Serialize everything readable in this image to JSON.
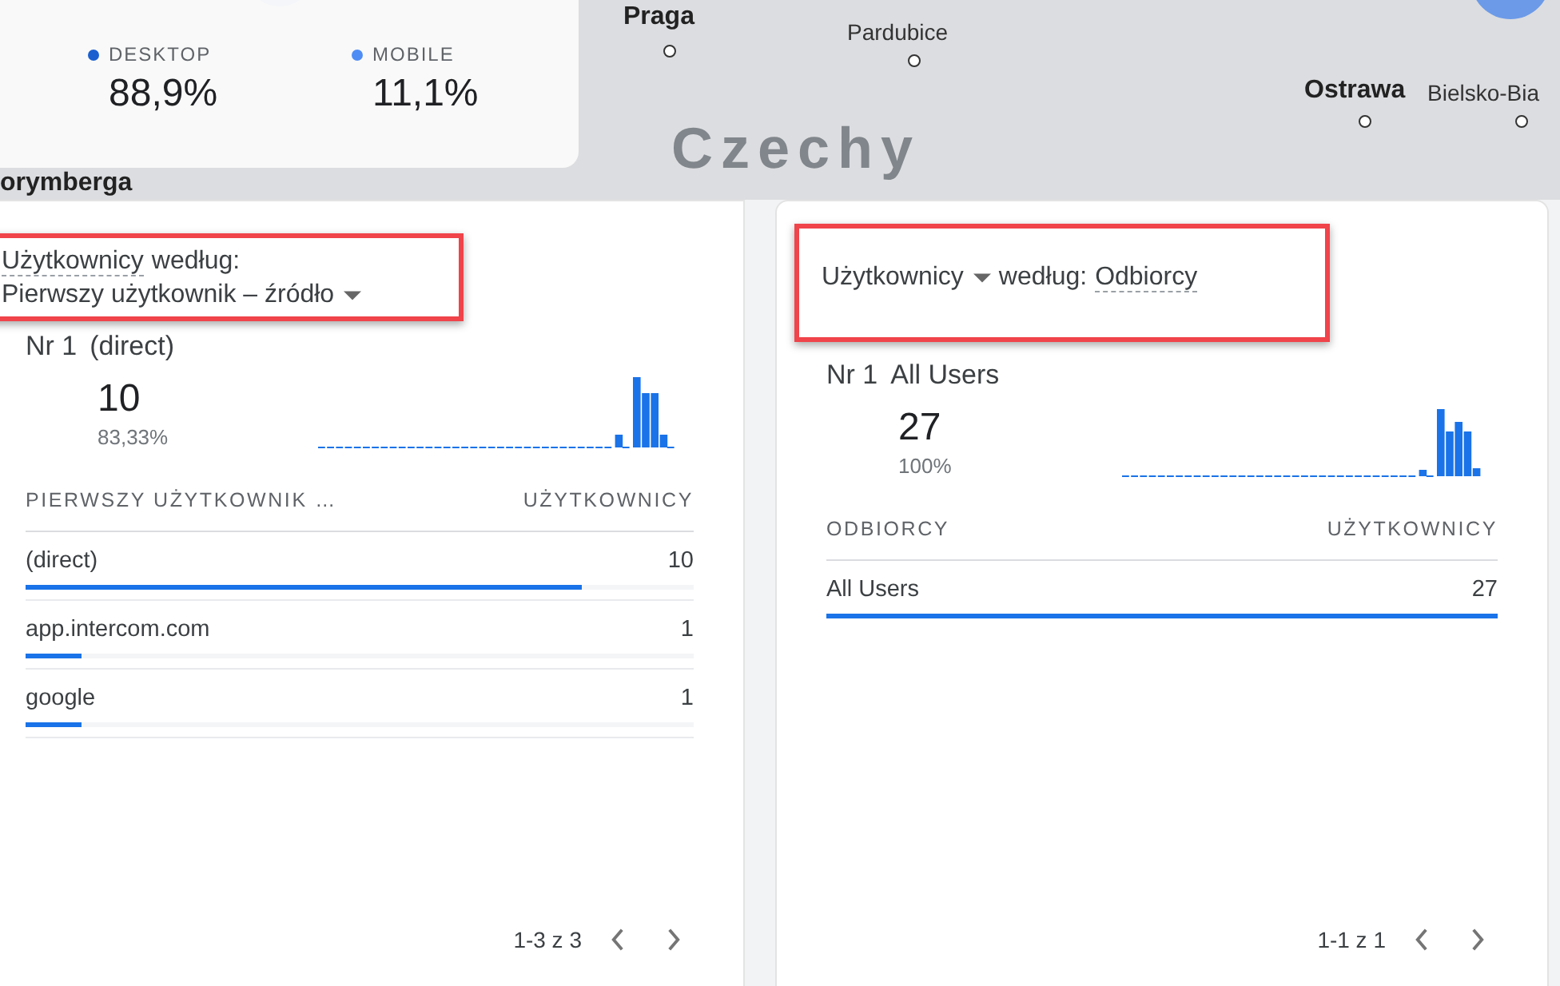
{
  "map": {
    "labels": [
      {
        "text": "Praga",
        "kind": "city"
      },
      {
        "text": "Pardubice",
        "kind": "town"
      },
      {
        "text": "Czechy",
        "kind": "country"
      },
      {
        "text": "Ostrawa",
        "kind": "city"
      },
      {
        "text": "Bielsko-Bia",
        "kind": "town"
      },
      {
        "text": "orymberga",
        "kind": "city"
      }
    ]
  },
  "devices": [
    {
      "label": "DESKTOP",
      "value": "88,9%",
      "color": "#1a5fd0"
    },
    {
      "label": "MOBILE",
      "value": "11,1%",
      "color": "#4f8df5"
    }
  ],
  "cards": [
    {
      "metric": {
        "text": "Użytkownicy",
        "dropdown": false
      },
      "by": "według:",
      "dimension": {
        "text": "Pierwszy użytkownik – źródło",
        "dropdown": true
      },
      "top_rank": "Nr 1",
      "top_name": "(direct)",
      "top_value": "10",
      "top_share": "83,33%",
      "columns": [
        "PIERWSZY UŻYTKOWNIK …",
        "UŻYTKOWNICY"
      ],
      "rows": [
        {
          "name": "(direct)",
          "value": "10",
          "level": 0.833
        },
        {
          "name": "app.intercom.com",
          "value": "1",
          "level": 0.083
        },
        {
          "name": "google",
          "value": "1",
          "level": 0.083
        }
      ],
      "pagination": "1-3 z 3"
    },
    {
      "metric": {
        "text": "Użytkownicy",
        "dropdown": true
      },
      "by": "według:",
      "dimension": {
        "text": "Odbiorcy",
        "dropdown": false
      },
      "top_rank": "Nr 1",
      "top_name": "All Users",
      "top_value": "27",
      "top_share": "100%",
      "columns": [
        "ODBIORCY",
        "UŻYTKOWNICY"
      ],
      "rows": [
        {
          "name": "All Users",
          "value": "27",
          "level": 1
        }
      ],
      "pagination": "1-1 z 1"
    }
  ]
}
